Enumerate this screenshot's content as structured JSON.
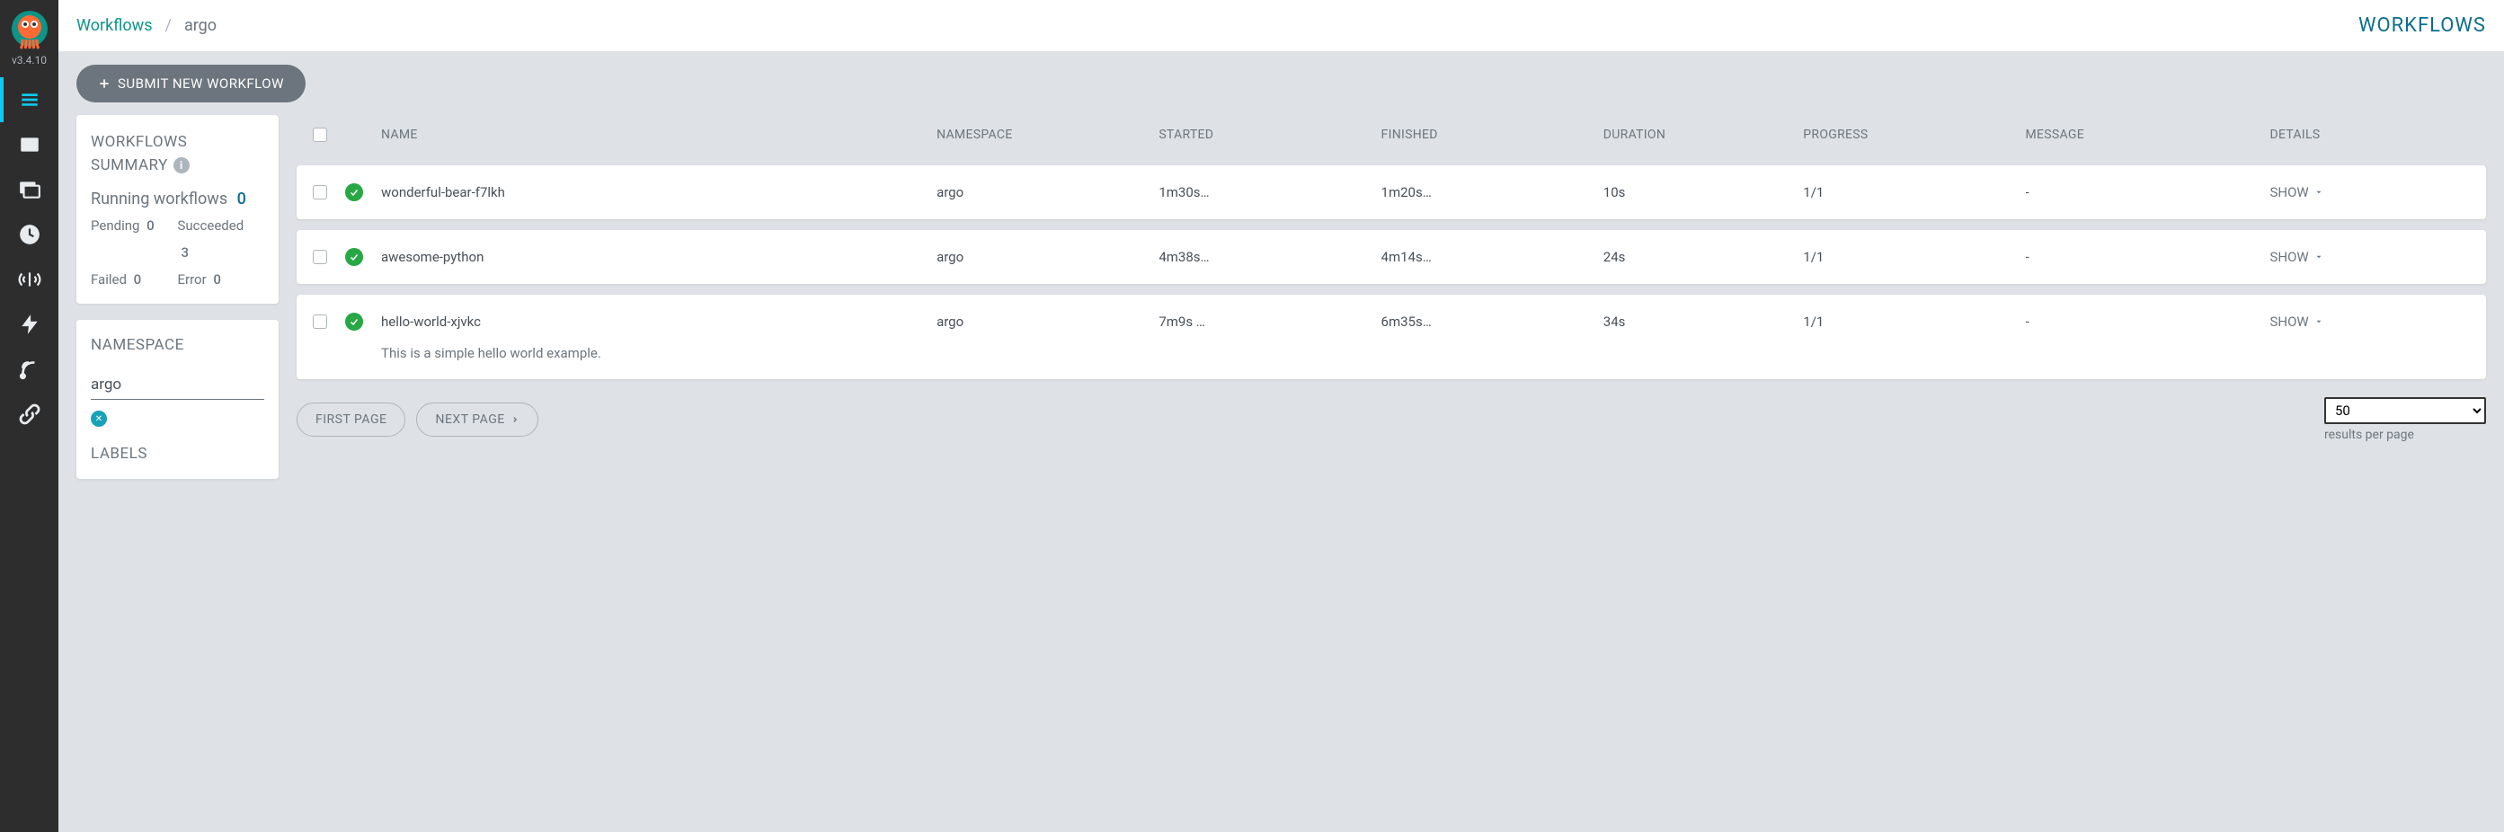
{
  "version": "v3.4.10",
  "breadcrumb": {
    "root": "Workflows",
    "current": "argo"
  },
  "page_title": "WORKFLOWS",
  "toolbar": {
    "submit_label": "SUBMIT NEW WORKFLOW"
  },
  "summary": {
    "title_l1": "WORKFLOWS",
    "title_l2": "SUMMARY",
    "running_label": "Running workflows",
    "running": "0",
    "pending_label": "Pending",
    "pending": "0",
    "succeeded_label": "Succeeded",
    "succeeded": "3",
    "failed_label": "Failed",
    "failed": "0",
    "error_label": "Error",
    "error": "0"
  },
  "namespace": {
    "label": "NAMESPACE",
    "value": "argo"
  },
  "labels": {
    "title": "LABELS"
  },
  "columns": {
    "name": "NAME",
    "namespace": "NAMESPACE",
    "started": "STARTED",
    "finished": "FINISHED",
    "duration": "DURATION",
    "progress": "PROGRESS",
    "message": "MESSAGE",
    "details": "DETAILS"
  },
  "rows": [
    {
      "name": "wonderful-bear-f7lkh",
      "namespace": "argo",
      "started": "1m30s…",
      "finished": "1m20s…",
      "duration": "10s",
      "progress": "1/1",
      "message": "-",
      "details": "SHOW"
    },
    {
      "name": "awesome-python",
      "namespace": "argo",
      "started": "4m38s…",
      "finished": "4m14s…",
      "duration": "24s",
      "progress": "1/1",
      "message": "-",
      "details": "SHOW"
    },
    {
      "name": "hello-world-xjvkc",
      "namespace": "argo",
      "started": "7m9s …",
      "finished": "6m35s…",
      "duration": "34s",
      "progress": "1/1",
      "message": "-",
      "details": "SHOW",
      "extra": "This is a simple hello world example."
    }
  ],
  "pager": {
    "first": "FIRST PAGE",
    "next": "NEXT PAGE",
    "rpp_value": "50",
    "rpp_label": "results per page"
  }
}
